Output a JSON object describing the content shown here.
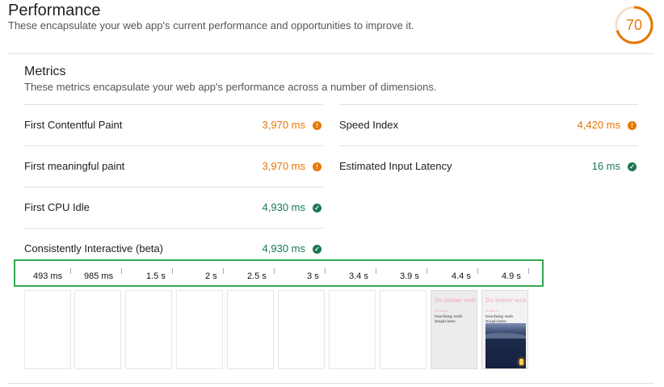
{
  "performance": {
    "title": "Performance",
    "description": "These encapsulate your web app's current performance and opportunities to improve it.",
    "score": "70",
    "score_fraction": 0.7,
    "score_color": "#e67700"
  },
  "metrics": {
    "title": "Metrics",
    "description": "These metrics encapsulate your web app's performance across a number of dimensions.",
    "items": [
      {
        "name": "First Contentful Paint",
        "value": "3,970 ms",
        "status": "average"
      },
      {
        "name": "Speed Index",
        "value": "4,420 ms",
        "status": "average"
      },
      {
        "name": "First meaningful paint",
        "value": "3,970 ms",
        "status": "average"
      },
      {
        "name": "Estimated Input Latency",
        "value": "16 ms",
        "status": "pass"
      },
      {
        "name": "First CPU Idle",
        "value": "4,930 ms",
        "status": "pass"
      },
      {
        "name": "Consistently Interactive (beta)",
        "value": "4,930 ms",
        "status": "pass"
      }
    ],
    "status_colors": {
      "average": "#e67700",
      "pass": "#18794e"
    },
    "status_icons": {
      "average": "info-icon",
      "pass": "check-icon"
    }
  },
  "filmstrip": {
    "ticks": [
      "493 ms",
      "985 ms",
      "1.5 s",
      "2 s",
      "2.5 s",
      "3 s",
      "3.4 s",
      "3.9 s",
      "4.4 s",
      "4.9 s"
    ],
    "frames": [
      {
        "type": "blank"
      },
      {
        "type": "blank"
      },
      {
        "type": "blank"
      },
      {
        "type": "blank"
      },
      {
        "type": "blank"
      },
      {
        "type": "blank"
      },
      {
        "type": "blank"
      },
      {
        "type": "blank"
      },
      {
        "type": "screenshot",
        "title": "Do better web",
        "small": "Hi there",
        "subtitle": "teaching web magicians"
      },
      {
        "type": "screenshot-image",
        "title": "Do better web",
        "small": "Hi there",
        "subtitle": "teaching web magicians"
      }
    ],
    "highlight_color": "#32a852"
  }
}
